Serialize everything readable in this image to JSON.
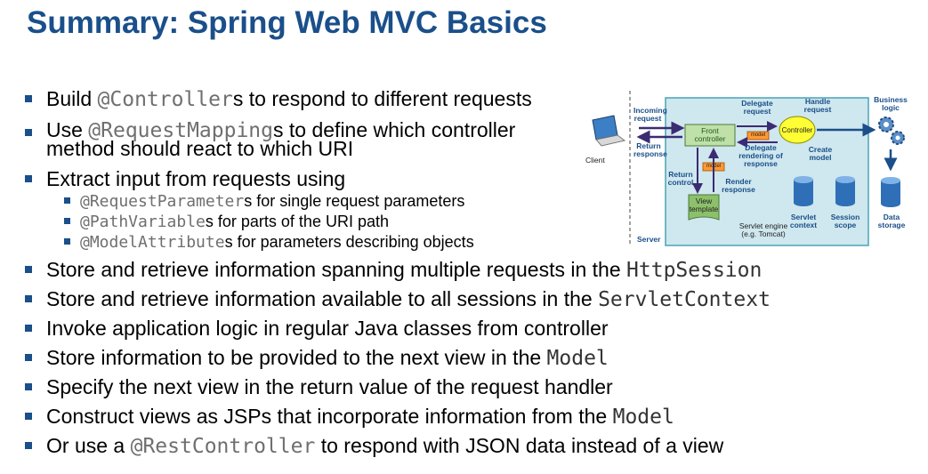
{
  "title": "Summary: Spring Web MVC Basics",
  "bullets": [
    {
      "mono": "@Controller",
      "pre": "Build ",
      "post": "s to respond to different requests"
    },
    {
      "pre": "Use ",
      "mono": "@RequestMapping",
      "post": "s to define which controller",
      "line2": "method should react to which URI"
    },
    {
      "text": "Extract input from requests using"
    },
    {
      "text": "Store and retrieve information spanning multiple requests in the ",
      "mono": "HttpSession"
    },
    {
      "text": "Store and retrieve information available to all sessions in the ",
      "mono": "ServletContext"
    },
    {
      "text": "Invoke application logic in regular Java classes from controller"
    },
    {
      "text": "Store information to be provided to the next view in the ",
      "mono": "Model"
    },
    {
      "text": "Specify the next view in the return value of the request handler"
    },
    {
      "text": "Construct views as JSPs that incorporate information from the ",
      "mono": "Model"
    },
    {
      "pre": "Or use a ",
      "mono": "@RestController",
      "post": "  to respond with JSON data instead of a view"
    }
  ],
  "subbullets": [
    {
      "mono": "@RequestParameter",
      "post": "s for single request parameters"
    },
    {
      "mono": "@PathVariable",
      "post": "s for parts of the URI path"
    },
    {
      "mono": "@ModelAttribute",
      "post": "s for parameters describing objects"
    }
  ],
  "diagram": {
    "client": "Client",
    "server": "Server",
    "incoming": "Incoming request",
    "return_response": "Return response",
    "delegate_request": "Delegate request",
    "handle_request": "Handle request",
    "delegate_rendering": "Delegate rendering of response",
    "create_model": "Create model",
    "return_control": "Return control",
    "render_response": "Render response",
    "front_controller": "Front controller",
    "controller": "Controller",
    "model": "model",
    "view_template": "View template",
    "servlet_engine": "Servlet engine (e.g. Tomcat)",
    "servlet_context": "Servlet context",
    "session_scope": "Session scope",
    "business_logic": "Business logic",
    "data_storage": "Data storage",
    "colors": {
      "accent": "#1a4f8a",
      "engine_bg": "#cfe7ee",
      "engine_border": "#4aa3b6",
      "box_green": "#bfe0a8",
      "controller_yellow": "#ffff33",
      "model_orange": "#ff9933"
    }
  }
}
